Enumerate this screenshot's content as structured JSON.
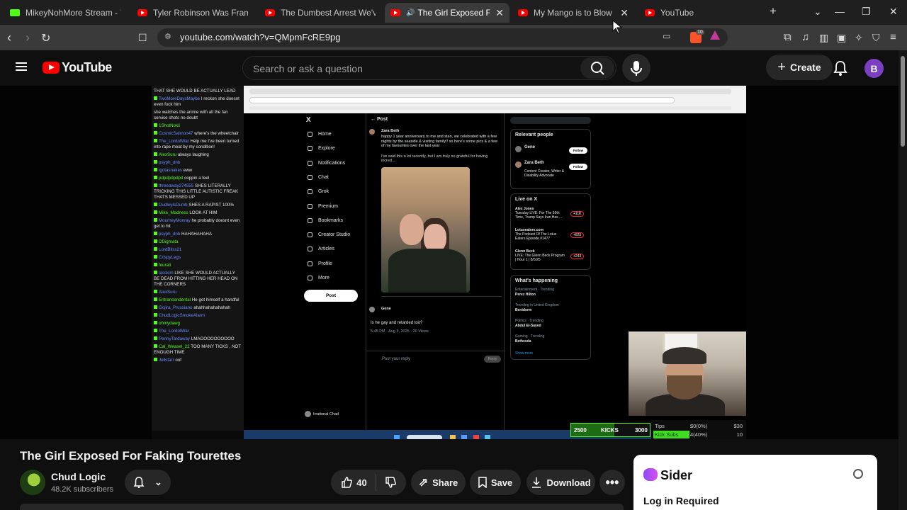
{
  "browser": {
    "tabs": [
      {
        "title": "MikeyNohMore Stream - Watch",
        "favicon": "kick-icon",
        "active": false
      },
      {
        "title": "Tyler Robinson Was Framed, H",
        "favicon": "youtube-icon",
        "active": false
      },
      {
        "title": "The Dumbest Arrest We've Eve",
        "favicon": "youtube-icon",
        "active": false
      },
      {
        "title": "The Girl Exposed For Fal",
        "favicon": "youtube-icon",
        "active": true
      },
      {
        "title": "My Mango is to Blow Up a",
        "favicon": "youtube-icon",
        "active": false
      },
      {
        "title": "YouTube",
        "favicon": "youtube-icon",
        "active": false
      }
    ],
    "url": "youtube.com/watch?v=QMpmFcRE9pg",
    "brave_badge": "10"
  },
  "youtube": {
    "logo_text": "YouTube",
    "search_placeholder": "Search or ask a question",
    "create_label": "Create",
    "avatar_letter": "B",
    "accent": "#ff0000"
  },
  "video_frame": {
    "chat": [
      {
        "user": "",
        "text": "THAT SHE WOULD BE ACTUALLY LEAD"
      },
      {
        "user": "TwoMoreDaysMaybe",
        "text": "I reckon she doesnt even fuck him"
      },
      {
        "user": "",
        "text": "she watches the anime with all the fan service shots no doubt"
      },
      {
        "user": "1ShotNokii",
        "text": ""
      },
      {
        "user": "CosmicSalmon47",
        "text": "where's the wheelchair"
      },
      {
        "user": "The_LordofWar",
        "text": "Help me I've been turned into rape meat by my condition!"
      },
      {
        "user": "AlexSuru",
        "text": "always laughing"
      },
      {
        "user": "psyph_dnb",
        "text": ""
      },
      {
        "user": "igotasnakes",
        "text": "eww"
      },
      {
        "user": "pdpdpdpdpd",
        "text": "coppin a feel"
      },
      {
        "user": "threeaway274555",
        "text": "SHES LITERALLY TRICKING THIS LITTLE AUTISTIC FREAK THATS MESSED UP"
      },
      {
        "user": "DudleyIsDumb",
        "text": "SHES A RAPIST 100%"
      },
      {
        "user": "Mike_Madness",
        "text": "LOOK AT HIM"
      },
      {
        "user": "MourneyMonray",
        "text": "he probably doesnt even get to hit"
      },
      {
        "user": "psyph_dnb",
        "text": "HAHAHAHAHA"
      },
      {
        "user": "DDigmata",
        "text": ""
      },
      {
        "user": "LordBliss21",
        "text": ""
      },
      {
        "user": "CrispyLegs",
        "text": ""
      },
      {
        "user": "fourati",
        "text": ""
      },
      {
        "user": "lasskim",
        "text": "LIKE SHE WOULD ACTUALLY BE DEAD FROM HITTING HER HEAD ON THE CORNERS"
      },
      {
        "user": "AlexSuru",
        "text": ""
      },
      {
        "user": "Entrancendental",
        "text": "He got himself a handful"
      },
      {
        "user": "Gojira_Prussiano",
        "text": "ahahhahahahahah"
      },
      {
        "user": "ChudLogicSmokeAlarm",
        "text": ""
      },
      {
        "user": "ohmydawg",
        "text": ""
      },
      {
        "user": "The_LordofWar",
        "text": ""
      },
      {
        "user": "PennyTardaway",
        "text": "LMAOOOOOOOOOO"
      },
      {
        "user": "Cal_Weasel_22",
        "text": "TOO MANY TICKS , NOT ENOUGH TIME"
      },
      {
        "user": "Jellstarr",
        "text": "oof"
      }
    ],
    "x_nav": [
      "Home",
      "Explore",
      "Notifications",
      "Chat",
      "Grok",
      "Premium",
      "Bookmarks",
      "Creator Studio",
      "Articles",
      "Profile",
      "More"
    ],
    "x_post_button": "Post",
    "x_logo": "X",
    "x_header": "Post",
    "x_account": "Irrational Chad",
    "post_author": "Zara Beth",
    "post_text": "happy 1 year anniversary to me and stan, we celebrated with a few nights by the seaside & visiting family!! so here's some pics & a few of my favourites over the last year",
    "post_text2": "I've said this a lot recently, but I am truly so grateful for having incred...",
    "reply_author": "Gene",
    "reply_text": "Is he gay and retarded too?",
    "reply_meta": "5:45 PM · Aug 3, 2025 · 20 Views",
    "reply_placeholder": "Post your reply",
    "reply_button": "Reply",
    "relevant_people_title": "Relevant people",
    "relevant_people": [
      {
        "name": "Gene",
        "follow": "Follow"
      },
      {
        "name": "Zara Beth",
        "bio": "Content Creator, Writer & Disability Advocate",
        "follow": "Follow"
      }
    ],
    "live_title": "Live on X",
    "live_items": [
      {
        "host": "Alex Jones",
        "title": "Tuesday LIVE: For The 55th Time, Trump Says Iran Has ...",
        "count": "+11K"
      },
      {
        "host": "Lotuseaters.com",
        "title": "The Podcast Of The Lotus Eaters Episode #1477",
        "count": "+825"
      },
      {
        "host": "Glenn Beck",
        "title": "LIVE: The Glenn Beck Program | Hour 1 | 8/5/25",
        "count": "+243"
      }
    ],
    "happening_title": "What's happening",
    "trends": [
      {
        "context": "Entertainment · Trending",
        "name": "Perez Hilton"
      },
      {
        "context": "Trending in United Kingdom",
        "name": "Benidorm"
      },
      {
        "context": "Politics · Trending",
        "name": "Abdul El-Sayed"
      },
      {
        "context": "Gaming · Trending",
        "name": "Bethesda"
      }
    ],
    "show_more": "Show more",
    "kicks": {
      "left": "2500",
      "label": "KICKS",
      "right": "3000",
      "progress": 0.55
    },
    "tips": {
      "label": "Tips",
      "value": "$0(0%)",
      "goal": "$30",
      "progress": 0.0
    },
    "subs": {
      "label": "Kick Subs",
      "value": "4(40%)",
      "goal": "10",
      "progress": 0.4
    }
  },
  "video": {
    "title": "The Girl Exposed For Faking Tourettes",
    "channel": "Chud Logic",
    "subscribers": "48.2K subscribers",
    "likes": "40",
    "share_label": "Share",
    "save_label": "Save",
    "download_label": "Download"
  },
  "sider": {
    "name": "Sider",
    "login": "Log in Required"
  }
}
